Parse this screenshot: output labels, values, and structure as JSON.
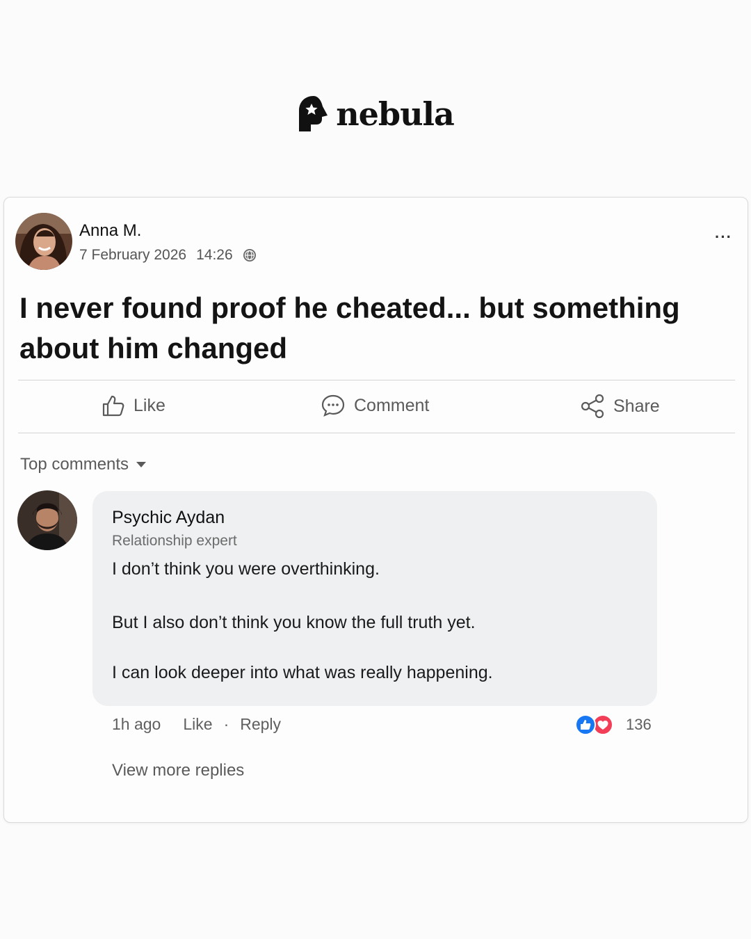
{
  "brand": {
    "name": "nebula",
    "icon": "head-star-logo-icon"
  },
  "post": {
    "author": "Anna M.",
    "date": "7 February 2026",
    "time": "14:26",
    "privacy_icon": "globe-icon",
    "more_label": "···",
    "title": "I never found proof he cheated... but something about him changed"
  },
  "actions": {
    "like": "Like",
    "comment": "Comment",
    "share": "Share"
  },
  "comments_header": {
    "label": "Top comments"
  },
  "comment": {
    "author": "Psychic Aydan",
    "role": "Relationship expert",
    "lines": [
      "I don’t think you were overthinking.",
      "But I also don’t think you know the full truth yet.",
      "I can look deeper into what was really happening."
    ],
    "time_ago": "1h ago",
    "like_label": "Like",
    "separator": "·",
    "reply_label": "Reply",
    "reaction_count": "136"
  },
  "view_more": "View more replies",
  "colors": {
    "like_blue": "#1877f2",
    "love_red": "#f33e58",
    "bubble_bg": "#eef0f2",
    "muted_text": "#5a5a5a"
  }
}
